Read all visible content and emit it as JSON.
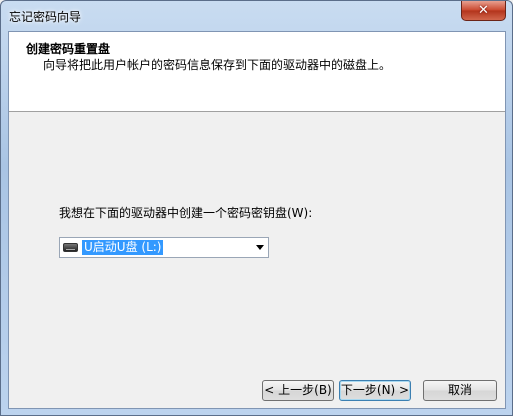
{
  "window": {
    "title": "忘记密码向导"
  },
  "header": {
    "title": "创建密码重置盘",
    "subtitle": "向导将把此用户帐户的密码信息保存到下面的驱动器中的磁盘上。"
  },
  "body": {
    "prompt": "我想在下面的驱动器中创建一个密码密钥盘(W):",
    "drive_select": {
      "selected": "U启动U盘 (L:)"
    }
  },
  "buttons": {
    "back": "< 上一步(B)",
    "next": "下一步(N) >",
    "cancel": "取消"
  },
  "colors": {
    "selection": "#3399ff",
    "close": "#c9462c"
  }
}
